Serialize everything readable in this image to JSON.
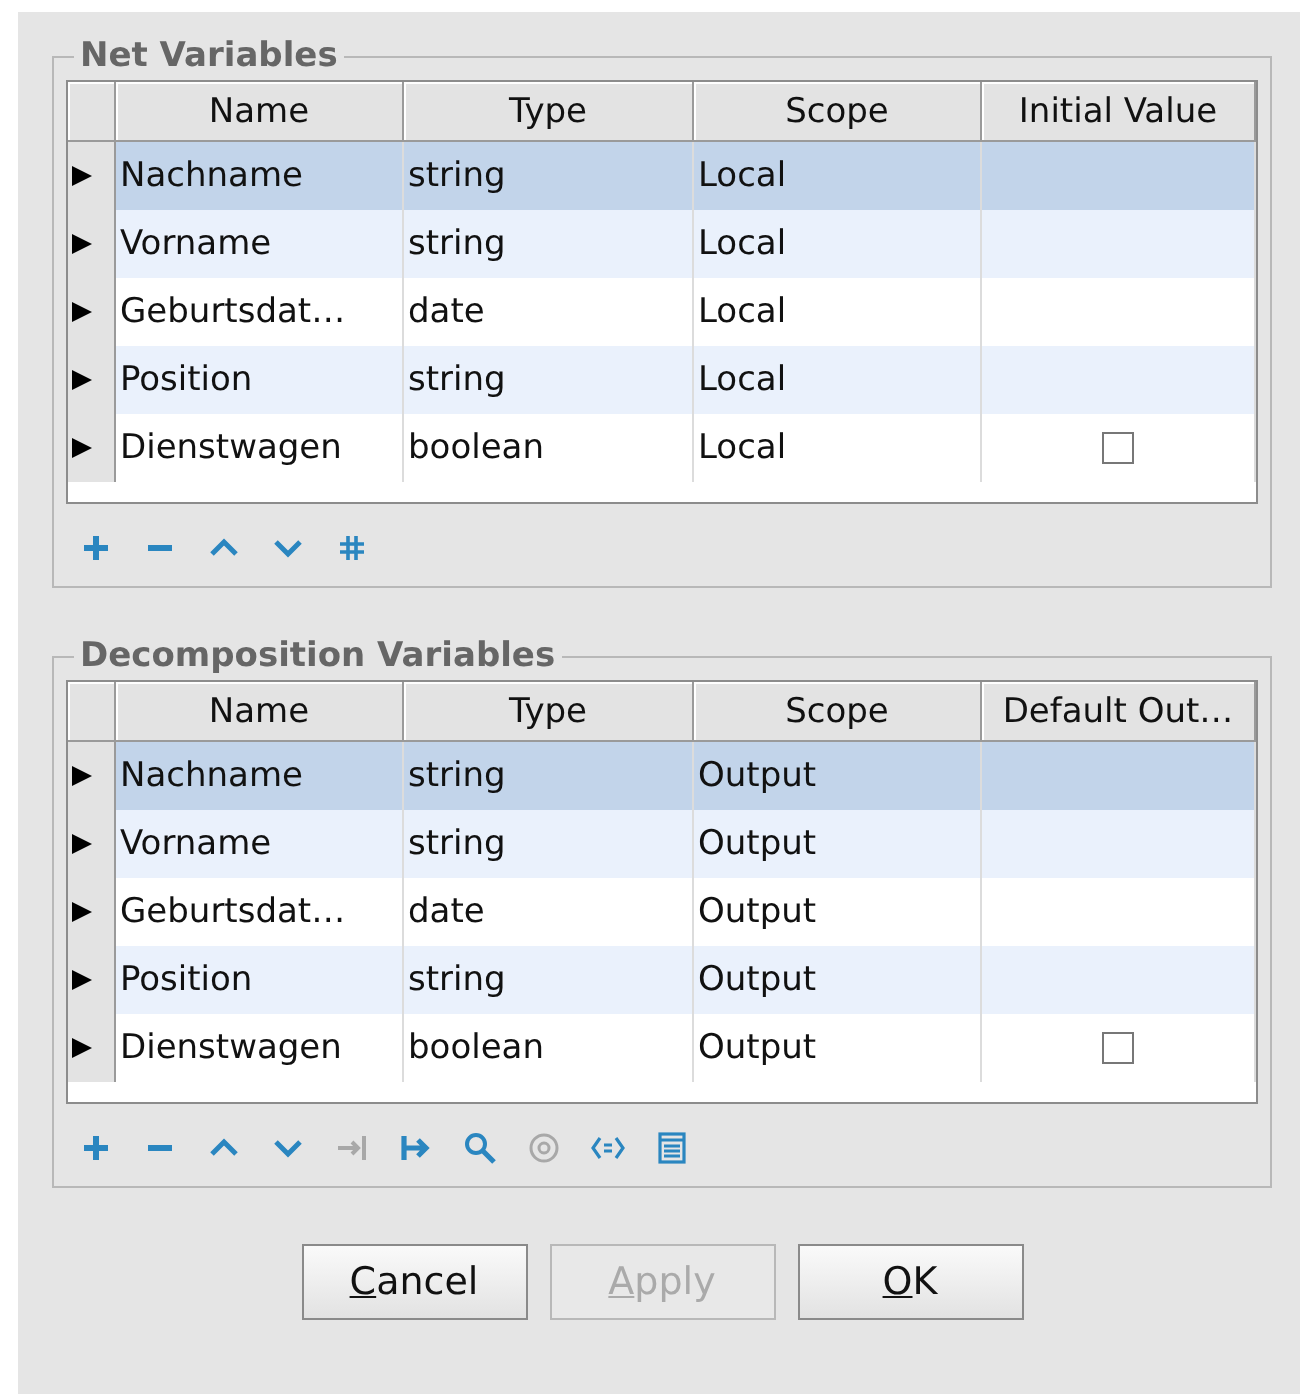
{
  "sections": [
    {
      "title": "Net Variables",
      "columns": [
        "Name",
        "Type",
        "Scope",
        "Initial Value"
      ],
      "rows": [
        {
          "name": "Nachname",
          "type": "string",
          "scope": "Local",
          "selected": true
        },
        {
          "name": "Vorname",
          "type": "string",
          "scope": "Local",
          "selected": false
        },
        {
          "name": "Geburtsdat…",
          "type": "date",
          "scope": "Local",
          "selected": false
        },
        {
          "name": "Position",
          "type": "string",
          "scope": "Local",
          "selected": false
        },
        {
          "name": "Dienstwagen",
          "type": "boolean",
          "scope": "Local",
          "selected": false,
          "checked": false
        }
      ],
      "tools": [
        {
          "kind": "add",
          "disabled": false
        },
        {
          "kind": "remove",
          "disabled": false
        },
        {
          "kind": "up",
          "disabled": false
        },
        {
          "kind": "down",
          "disabled": false
        },
        {
          "kind": "hash",
          "disabled": false
        }
      ]
    },
    {
      "title": "Decomposition Variables",
      "columns": [
        "Name",
        "Type",
        "Scope",
        "Default Out…"
      ],
      "rows": [
        {
          "name": "Nachname",
          "type": "string",
          "scope": "Output",
          "selected": true
        },
        {
          "name": "Vorname",
          "type": "string",
          "scope": "Output",
          "selected": false
        },
        {
          "name": "Geburtsdat…",
          "type": "date",
          "scope": "Output",
          "selected": false
        },
        {
          "name": "Position",
          "type": "string",
          "scope": "Output",
          "selected": false
        },
        {
          "name": "Dienstwagen",
          "type": "boolean",
          "scope": "Output",
          "selected": false,
          "checked": false
        }
      ],
      "tools": [
        {
          "kind": "add",
          "disabled": false
        },
        {
          "kind": "remove",
          "disabled": false
        },
        {
          "kind": "up",
          "disabled": false
        },
        {
          "kind": "down",
          "disabled": false
        },
        {
          "kind": "tab-end",
          "disabled": true
        },
        {
          "kind": "map",
          "disabled": false
        },
        {
          "kind": "search",
          "disabled": false
        },
        {
          "kind": "target",
          "disabled": true
        },
        {
          "kind": "brackets",
          "disabled": false
        },
        {
          "kind": "list",
          "disabled": false
        }
      ]
    }
  ],
  "buttons": [
    {
      "label": "Cancel",
      "mnemonic_underlined": true,
      "disabled": false
    },
    {
      "label": "Apply",
      "mnemonic_underlined": true,
      "disabled": true
    },
    {
      "label": "OK",
      "mnemonic_underlined": true,
      "disabled": false
    }
  ]
}
